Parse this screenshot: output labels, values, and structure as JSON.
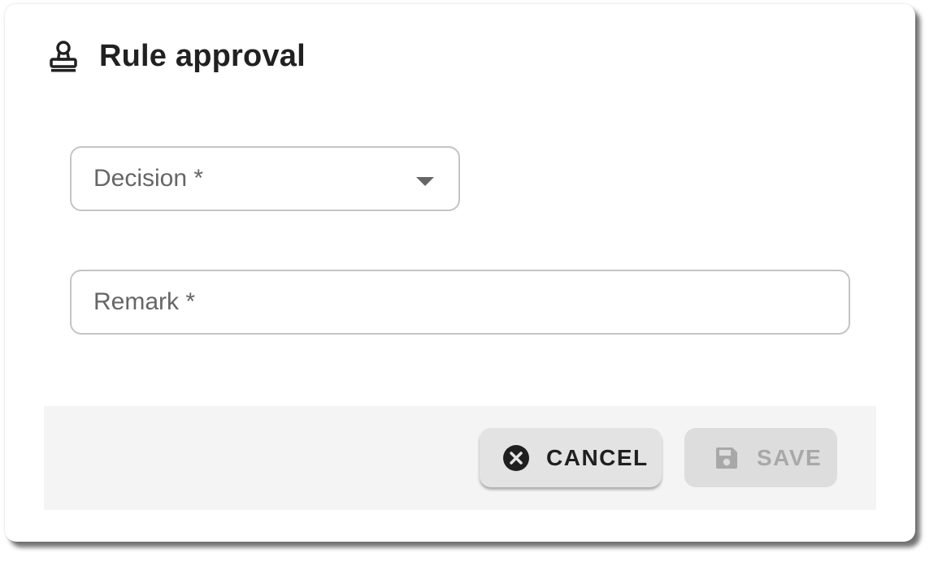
{
  "dialog": {
    "title": "Rule approval",
    "title_icon": "stamp-icon"
  },
  "form": {
    "decision": {
      "label": "Decision *",
      "value": "",
      "icon": "dropdown-arrow-icon"
    },
    "remark": {
      "label": "Remark *",
      "value": ""
    }
  },
  "actions": {
    "cancel": {
      "label": "CANCEL",
      "icon": "cancel-circle-icon",
      "enabled": true
    },
    "save": {
      "label": "SAVE",
      "icon": "floppy-disk-icon",
      "enabled": false
    }
  },
  "colors": {
    "text_primary": "#212121",
    "label_gray": "#666666",
    "border_gray": "#c4c4c4",
    "actions_bg": "#f4f4f4",
    "disabled_text": "#a8a8a8"
  }
}
